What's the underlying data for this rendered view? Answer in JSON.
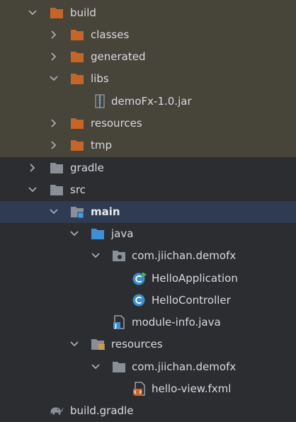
{
  "tree": {
    "build": "build",
    "classes": "classes",
    "generated": "generated",
    "libs": "libs",
    "jar": "demoFx-1.0.jar",
    "resources_build": "resources",
    "tmp": "tmp",
    "gradle": "gradle",
    "src": "src",
    "main": "main",
    "java": "java",
    "package_main": "com.jiichan.demofx",
    "hello_application": "HelloApplication",
    "hello_controller": "HelloController",
    "module_info": "module-info.java",
    "resources_src": "resources",
    "package_resources": "com.jiichan.demofx",
    "fxml": "hello-view.fxml",
    "build_gradle": "build.gradle"
  },
  "colors": {
    "build_highlight": "#47443a",
    "selection": "#2f3b52",
    "excluded_folder": "#c4652a",
    "plain_folder": "#8a8e96",
    "source_folder": "#3f8fd8",
    "class_icon": "#3d8ec9"
  }
}
